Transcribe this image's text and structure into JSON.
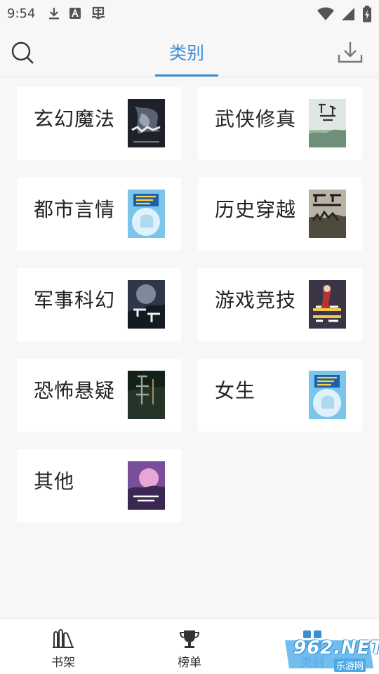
{
  "status_bar": {
    "time": "9:54"
  },
  "header": {
    "title": "类别"
  },
  "colors": {
    "accent": "#3a8ed6",
    "background": "#f7f7f7",
    "card": "#ffffff"
  },
  "categories": [
    {
      "label": "玄幻魔法"
    },
    {
      "label": "武侠修真"
    },
    {
      "label": "都市言情"
    },
    {
      "label": "历史穿越"
    },
    {
      "label": "军事科幻"
    },
    {
      "label": "游戏竞技"
    },
    {
      "label": "恐怖悬疑"
    },
    {
      "label": "女生"
    },
    {
      "label": "其他"
    }
  ],
  "bottom_nav": {
    "bookshelf_label": "书架",
    "ranking_label": "榜单",
    "category_label": "类别"
  },
  "watermark": {
    "text": "962.NET",
    "sub": "乐游网"
  }
}
